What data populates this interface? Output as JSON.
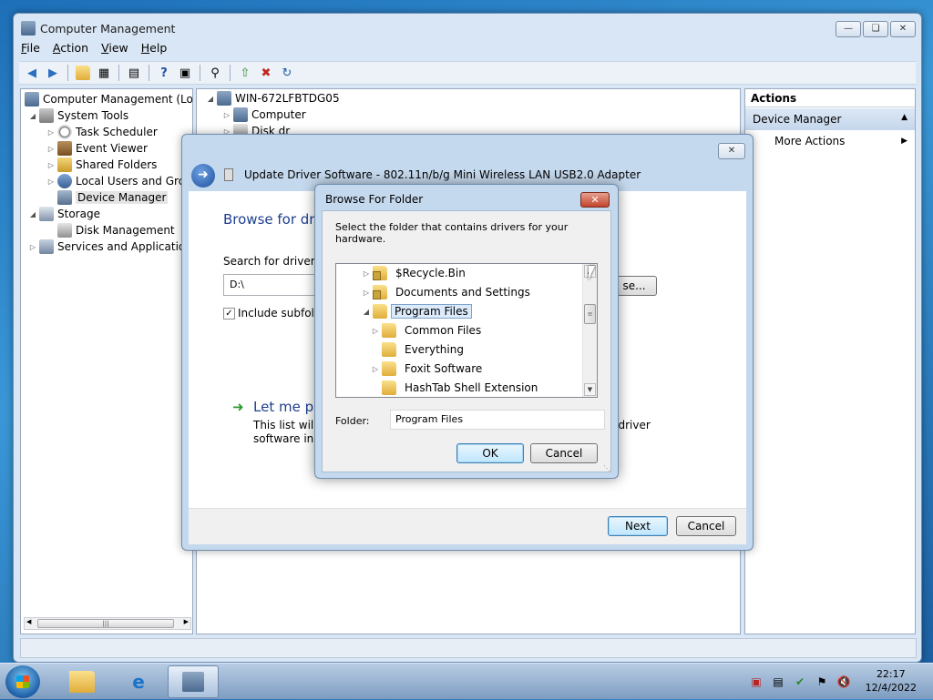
{
  "main_window": {
    "title": "Computer Management",
    "menu": [
      "File",
      "Action",
      "View",
      "Help"
    ],
    "tree": [
      {
        "label": "Computer Management (Local",
        "level": 0,
        "twisty": "expanded",
        "icon": "computer-management-icon"
      },
      {
        "label": "System Tools",
        "level": 1,
        "twisty": "expanded",
        "icon": "tools-icon"
      },
      {
        "label": "Task Scheduler",
        "level": 2,
        "twisty": "collapsed",
        "icon": "clock-icon"
      },
      {
        "label": "Event Viewer",
        "level": 2,
        "twisty": "collapsed",
        "icon": "event-viewer-icon"
      },
      {
        "label": "Shared Folders",
        "level": 2,
        "twisty": "collapsed",
        "icon": "shared-folders-icon"
      },
      {
        "label": "Local Users and Group",
        "level": 2,
        "twisty": "collapsed",
        "icon": "users-icon"
      },
      {
        "label": "Device Manager",
        "level": 2,
        "twisty": "none",
        "icon": "device-manager-icon",
        "selected": true
      },
      {
        "label": "Storage",
        "level": 1,
        "twisty": "expanded",
        "icon": "storage-icon"
      },
      {
        "label": "Disk Management",
        "level": 2,
        "twisty": "none",
        "icon": "disk-icon"
      },
      {
        "label": "Services and Applications",
        "level": 1,
        "twisty": "collapsed",
        "icon": "services-icon"
      }
    ],
    "center_tree": [
      {
        "label": "WIN-672LFBTDG05",
        "twisty": "expanded"
      },
      {
        "label": "Computer",
        "twisty": "collapsed"
      },
      {
        "label": "Disk dr",
        "twisty": "collapsed"
      }
    ],
    "actions": {
      "header": "Actions",
      "section": "Device Manager",
      "item": "More Actions"
    }
  },
  "driver_dialog": {
    "title": "Update Driver Software - 802.11n/b/g Mini Wireless LAN USB2.0 Adapter",
    "heading": "Browse for driv",
    "search_label": "Search for driver so",
    "path_value": "D:\\",
    "browse_label": "se...",
    "include_subfolders_label": "Include subfolde",
    "include_subfolders_checked": true,
    "let_me_pick": "Let me pic",
    "let_me_pick_desc_line1_left": "This list will s",
    "let_me_pick_desc_line1_right": "ll driver",
    "let_me_pick_desc_line2": "software in th",
    "next_label": "Next",
    "cancel_label": "Cancel"
  },
  "browse_dialog": {
    "title": "Browse For Folder",
    "instruction": "Select the folder that contains drivers for your hardware.",
    "folders": [
      {
        "label": "$Recycle.Bin",
        "level": 0,
        "twisty": "collapsed",
        "locked": true
      },
      {
        "label": "Documents and Settings",
        "level": 0,
        "twisty": "collapsed",
        "locked": true
      },
      {
        "label": "Program Files",
        "level": 0,
        "twisty": "expanded",
        "locked": false,
        "selected": true
      },
      {
        "label": "Common Files",
        "level": 1,
        "twisty": "collapsed",
        "locked": false
      },
      {
        "label": "Everything",
        "level": 1,
        "twisty": "none",
        "locked": false
      },
      {
        "label": "Foxit Software",
        "level": 1,
        "twisty": "collapsed",
        "locked": false
      },
      {
        "label": "HashTab Shell Extension",
        "level": 1,
        "twisty": "none",
        "locked": false
      }
    ],
    "folder_label": "Folder:",
    "folder_value": "Program Files",
    "ok_label": "OK",
    "cancel_label": "Cancel"
  },
  "taskbar": {
    "clock_time": "22:17",
    "clock_date": "12/4/2022"
  }
}
